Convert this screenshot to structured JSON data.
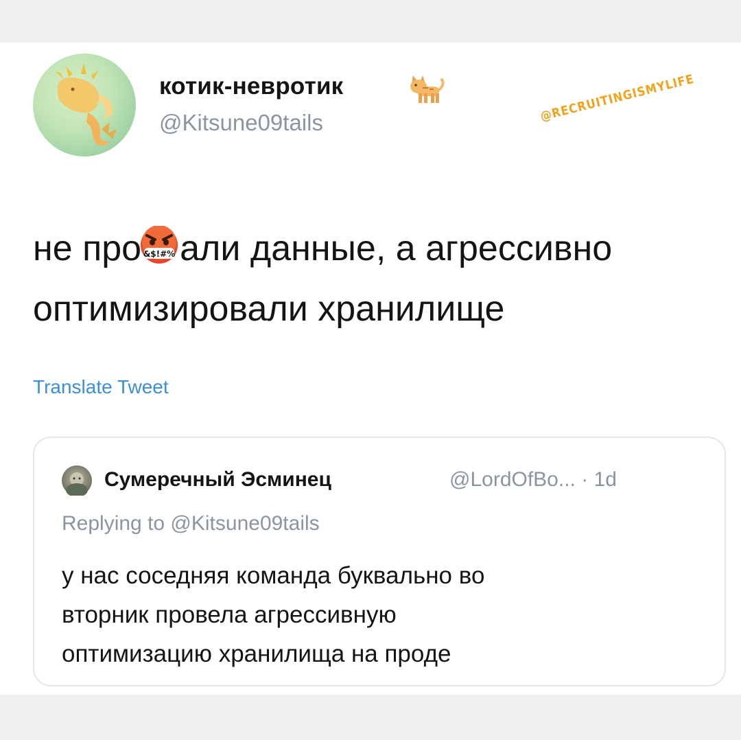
{
  "tweet": {
    "author_name": "котик-невротик",
    "author_name_emoji_icon": "cat-emoji-icon",
    "author_handle": "@Kitsune09tails",
    "text_line1_before": "не про",
    "censor_symbols": "&$!#%",
    "censor_icon": "angry-cursing-face-icon",
    "text_line1_after": "али данные, а агрессивно",
    "text_line2": "оптимизировали хранилище",
    "translate_label": "Translate Tweet"
  },
  "watermark": "@RECRUITINGISMYLIFE",
  "quoted_tweet": {
    "author_name": "Сумеречный Эсминец",
    "author_handle_time": "@LordOfBo... · 1d",
    "replying_to": "Replying to @Kitsune09tails",
    "text_lines": [
      "у нас соседняя команда буквально во",
      "вторник провела агрессивную",
      "оптимизацию хранилища на проде"
    ]
  },
  "colors": {
    "text_primary": "#141414",
    "text_secondary": "#8a959e",
    "link_blue": "#3b8fd6",
    "watermark_orange": "#f2a21b",
    "quote_border": "#e3e7ea"
  }
}
